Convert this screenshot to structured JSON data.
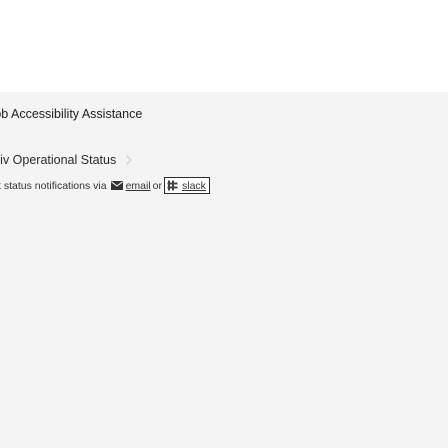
{
  "footer": {
    "section_title": "ɔb Accessibility Assistance",
    "status_link": "‹iv Operational Status",
    "notify_text": "t status notifications via",
    "email_label": "email",
    "or_text": "or",
    "slack_label": "slack"
  },
  "icons": {
    "chevron": "chevron-right-icon",
    "mail": "mail-icon",
    "slack": "slack-icon"
  }
}
